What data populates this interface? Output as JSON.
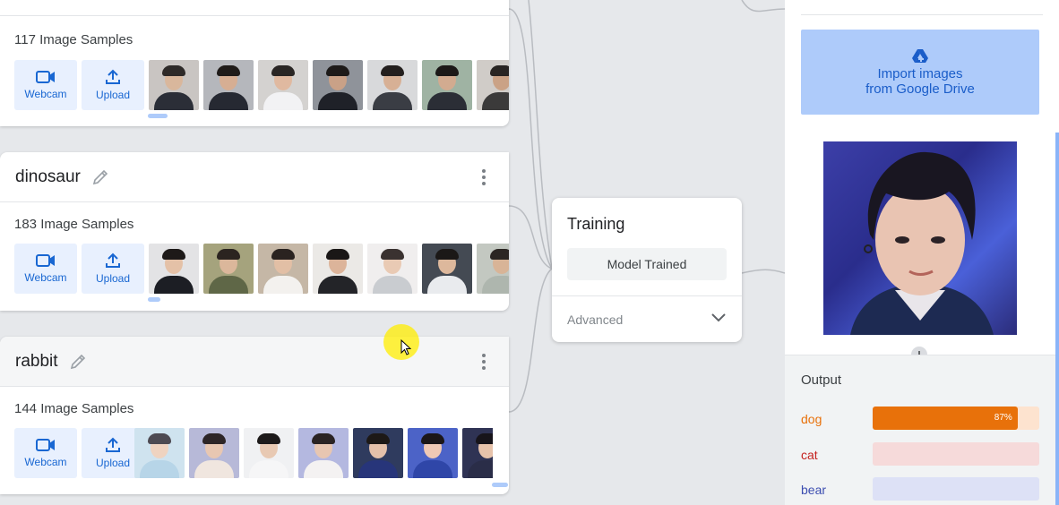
{
  "class_cards": [
    {
      "name": "",
      "samples_label": "117 Image Samples",
      "webcam_label": "Webcam",
      "upload_label": "Upload",
      "thumb_palettes": [
        [
          "#c9c5c2",
          "#d9b79c",
          "#2e2a28",
          "#2b2e37"
        ],
        [
          "#b5b7bc",
          "#d6ae93",
          "#1f1b19",
          "#262932"
        ],
        [
          "#d4d2d0",
          "#e0b9a0",
          "#2a2624",
          "#f2f2f4"
        ],
        [
          "#8f939a",
          "#c9a187",
          "#1d1a19",
          "#1f2128"
        ],
        [
          "#d8d9db",
          "#d7b095",
          "#231f1e",
          "#3a3d44"
        ],
        [
          "#9fb3a3",
          "#d2ab90",
          "#1c1918",
          "#2b2e36"
        ],
        [
          "#d0ccc8",
          "#caa286",
          "#292523",
          "#3b3a3a"
        ]
      ]
    },
    {
      "name": "dinosaur",
      "samples_label": "183 Image Samples",
      "webcam_label": "Webcam",
      "upload_label": "Upload",
      "thumb_palettes": [
        [
          "#e3e3e5",
          "#e4c1a7",
          "#1d1918",
          "#1c1e24"
        ],
        [
          "#a5a37d",
          "#dbb79b",
          "#2b2420",
          "#5f6747"
        ],
        [
          "#c5b7a6",
          "#e2bfa5",
          "#2a2320",
          "#f3f1ee"
        ],
        [
          "#ebe9e6",
          "#dcb49a",
          "#1a1716",
          "#232428"
        ],
        [
          "#f0eeee",
          "#e9cab4",
          "#3a3230",
          "#c9ccd0"
        ],
        [
          "#444a53",
          "#ddb89c",
          "#1b1817",
          "#e9ebee"
        ],
        [
          "#c3c8c1",
          "#d8b497",
          "#2b2623",
          "#aeb6ae"
        ]
      ]
    },
    {
      "name": "rabbit",
      "samples_label": "144 Image Samples",
      "webcam_label": "Webcam",
      "upload_label": "Upload",
      "thumb_palettes": [
        [
          "#cfe3ef",
          "#efd3c0",
          "#4d4a52",
          "#b7d5e8"
        ],
        [
          "#b7b9d8",
          "#e8c7b2",
          "#2d2527",
          "#f0e6df"
        ],
        [
          "#f0f1f3",
          "#e8c9b3",
          "#1d1a1a",
          "#f6f6f7"
        ],
        [
          "#b4b8e0",
          "#e7c6b1",
          "#2a2323",
          "#f4f2f2"
        ],
        [
          "#2f3b5e",
          "#e4c1aa",
          "#1d1917",
          "#27357a"
        ],
        [
          "#4c63c7",
          "#f0c9b5",
          "#1c1719",
          "#2f46a8"
        ],
        [
          "#2f3354",
          "#e7c3ab",
          "#17141a",
          "#2a2d48"
        ]
      ]
    }
  ],
  "training": {
    "title": "Training",
    "status_button": "Model Trained",
    "advanced_label": "Advanced"
  },
  "preview": {
    "import_button_line1": "Import images",
    "import_button_line2": "from Google Drive",
    "output_title": "Output",
    "outputs": [
      {
        "label": "dog",
        "confidence": 0.87,
        "percent_text": "87%",
        "color": "#e8710a",
        "label_color": "#e8710a",
        "track_color": "#fde3cf"
      },
      {
        "label": "cat",
        "confidence": 0,
        "percent_text": "",
        "color": "#e37a7a",
        "label_color": "#c5221f",
        "track_color": "#f6dada"
      },
      {
        "label": "bear",
        "confidence": 0,
        "percent_text": "",
        "color": "#7b8ed8",
        "label_color": "#3c4db0",
        "track_color": "#dde1f6"
      }
    ]
  },
  "icons": {
    "webcam": "video-camera-icon",
    "upload": "upload-arrow-icon",
    "edit": "pencil-icon",
    "more": "more-vertical-icon",
    "drive": "google-drive-icon",
    "expand": "chevron-down-icon",
    "flow": "arrow-down-icon"
  },
  "colors": {
    "accent": "#1967d2",
    "button_bg": "#e8f0fe",
    "drive_bg": "#aecbfa",
    "canvas_bg": "#e6e8eb"
  }
}
